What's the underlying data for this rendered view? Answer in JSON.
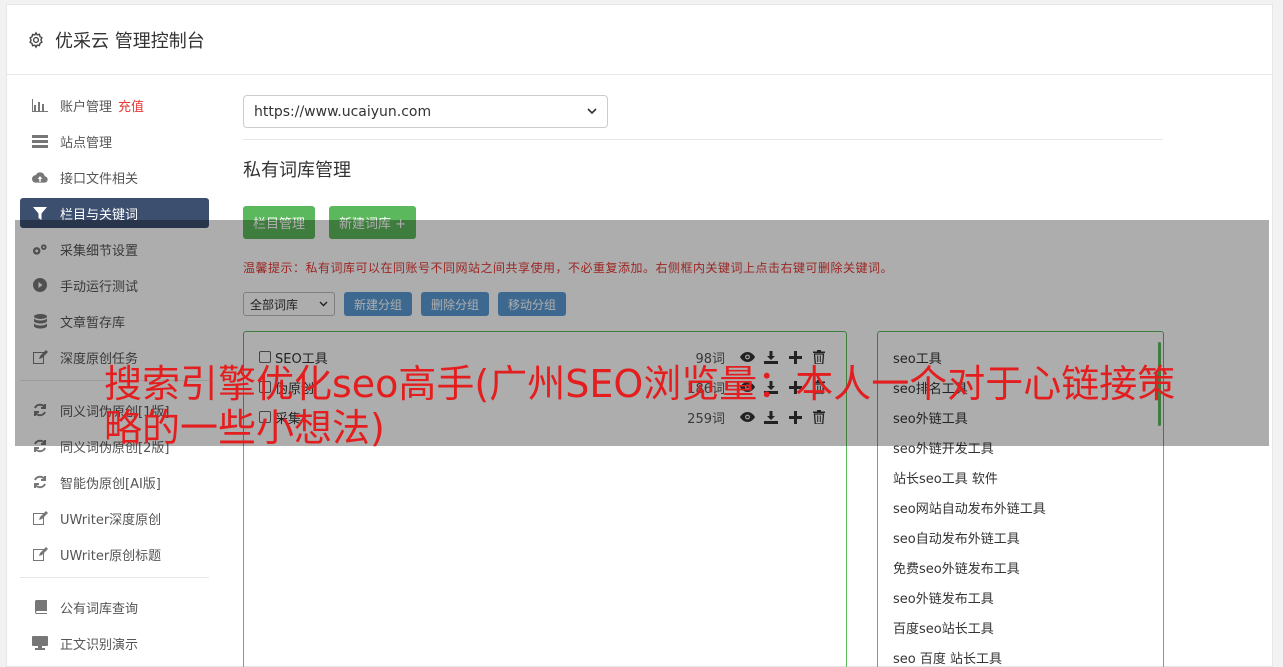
{
  "header": {
    "title": "优采云 管理控制台",
    "icon": "gear-icon"
  },
  "sidebar": {
    "groups": [
      [
        {
          "label": "账户管理",
          "badge": "充值",
          "icon": "bar-chart-icon"
        },
        {
          "label": "站点管理",
          "icon": "server-icon"
        },
        {
          "label": "接口文件相关",
          "icon": "cloud-upload-icon"
        },
        {
          "label": "栏目与关键词",
          "icon": "filter-icon",
          "active": true
        },
        {
          "label": "采集细节设置",
          "icon": "cogs-icon"
        },
        {
          "label": "手动运行测试",
          "icon": "play-circle-icon"
        },
        {
          "label": "文章暂存库",
          "icon": "database-icon"
        },
        {
          "label": "深度原创任务",
          "icon": "edit-icon"
        }
      ],
      [
        {
          "label": "同义词伪原创[1版]",
          "icon": "refresh-icon"
        },
        {
          "label": "同义词伪原创[2版]",
          "icon": "refresh-icon"
        },
        {
          "label": "智能伪原创[AI版]",
          "icon": "refresh-icon"
        },
        {
          "label": "UWriter深度原创",
          "icon": "edit-icon"
        },
        {
          "label": "UWriter原创标题",
          "icon": "edit-icon"
        }
      ],
      [
        {
          "label": "公有词库查询",
          "icon": "book-icon"
        },
        {
          "label": "正文识别演示",
          "icon": "monitor-icon"
        }
      ]
    ]
  },
  "main": {
    "site_select": "https://www.ucaiyun.com",
    "section_title": "私有词库管理",
    "buttons": {
      "column_manage": "栏目管理",
      "new_library": "新建词库 +"
    },
    "tip": "温馨提示：私有词库可以在同账号不同网站之间共享使用，不必重复添加。右侧框内关键词上点击右键可删除关键词。",
    "toolbar": {
      "filter": "全部词库",
      "new_group": "新建分组",
      "delete_group": "删除分组",
      "move_group": "移动分组"
    },
    "libraries": [
      {
        "name": "SEO工具",
        "count": "98词"
      },
      {
        "name": "伪原创",
        "count": "186词"
      },
      {
        "name": "采集",
        "count": "259词"
      }
    ],
    "keywords": [
      "seo工具",
      "seo排名工具",
      "seo外链工具",
      "seo外链开发工具",
      "站长seo工具 软件",
      "seo网站自动发布外链工具",
      "seo自动发布外链工具",
      "免费seo外链发布工具",
      "seo外链发布工具",
      "百度seo站长工具",
      "seo 百度 站长工具"
    ]
  },
  "overlay": {
    "headline": "搜索引擎优化seo高手(广州SEO浏览量：本人一个对于心链接策略的一些小想法)"
  },
  "colors": {
    "accent_green": "#5cb85c",
    "accent_blue": "#5b9bd5",
    "active_nav": "#3d4f6e",
    "alert_red": "#e53935"
  }
}
